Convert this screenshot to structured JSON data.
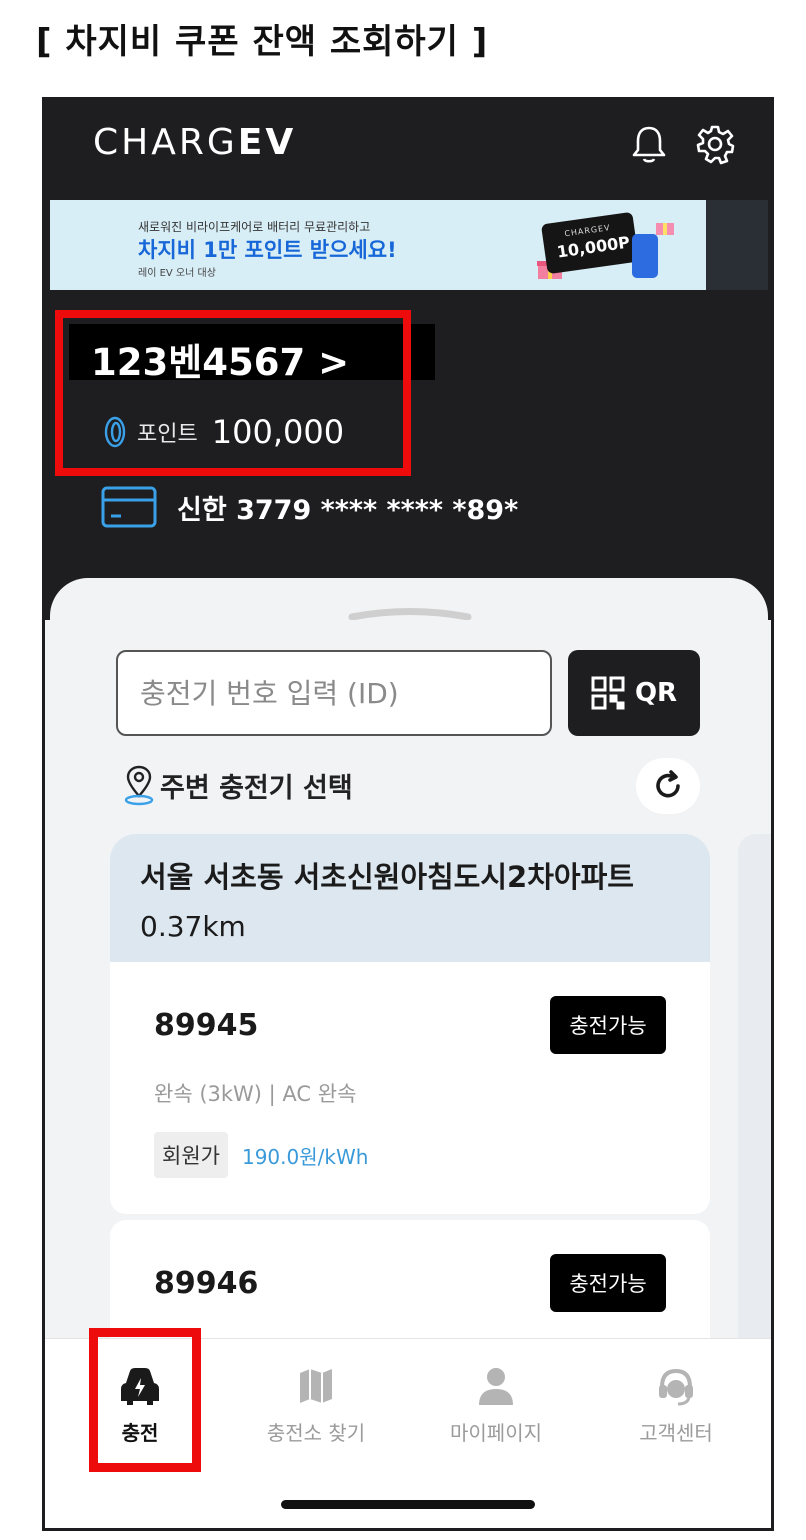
{
  "page_heading": "[ 차지비 쿠폰 잔액 조회하기 ]",
  "app": {
    "logo_light": "CHARG",
    "logo_bold": "EV"
  },
  "banner": {
    "line1": "새로워진 비라이프케어로 배터리 무료관리하고",
    "line2": "차지비 1만 포인트 받으세요!",
    "line3": "레이 EV 오너 대상",
    "ticket_brand": "CHARGEV",
    "ticket_amount": "10,000P"
  },
  "account": {
    "vehicle_plate": "123벤4567  >",
    "points_label": "포인트",
    "points_value": "100,000",
    "card": "신한 3779 **** **** *89*"
  },
  "search": {
    "placeholder": "충전기 번호 입력 (ID)",
    "qr_label": "QR"
  },
  "nearby": {
    "label": "주변 충전기 선택"
  },
  "station": {
    "name": "서울 서초동 서초신원아침도시2차아파트",
    "distance": "0.37km"
  },
  "chargers": [
    {
      "id": "89945",
      "status": "충전가능",
      "spec": "완속  (3kW)  | AC 완속",
      "member_tag": "회원가",
      "price": "190.0원/kWh"
    },
    {
      "id": "89946",
      "status": "충전가능"
    }
  ],
  "tabs": [
    {
      "label": "충전",
      "icon": "car-charging-icon",
      "active": true
    },
    {
      "label": "충전소 찾기",
      "icon": "map-icon",
      "active": false
    },
    {
      "label": "마이페이지",
      "icon": "person-icon",
      "active": false
    },
    {
      "label": "고객센터",
      "icon": "headset-icon",
      "active": false
    }
  ],
  "colors": {
    "highlight": "#ee0b0b",
    "dark_bg": "#1e1e21",
    "price_blue": "#3a9ad9",
    "card_icon_blue": "#3aa0e8"
  }
}
